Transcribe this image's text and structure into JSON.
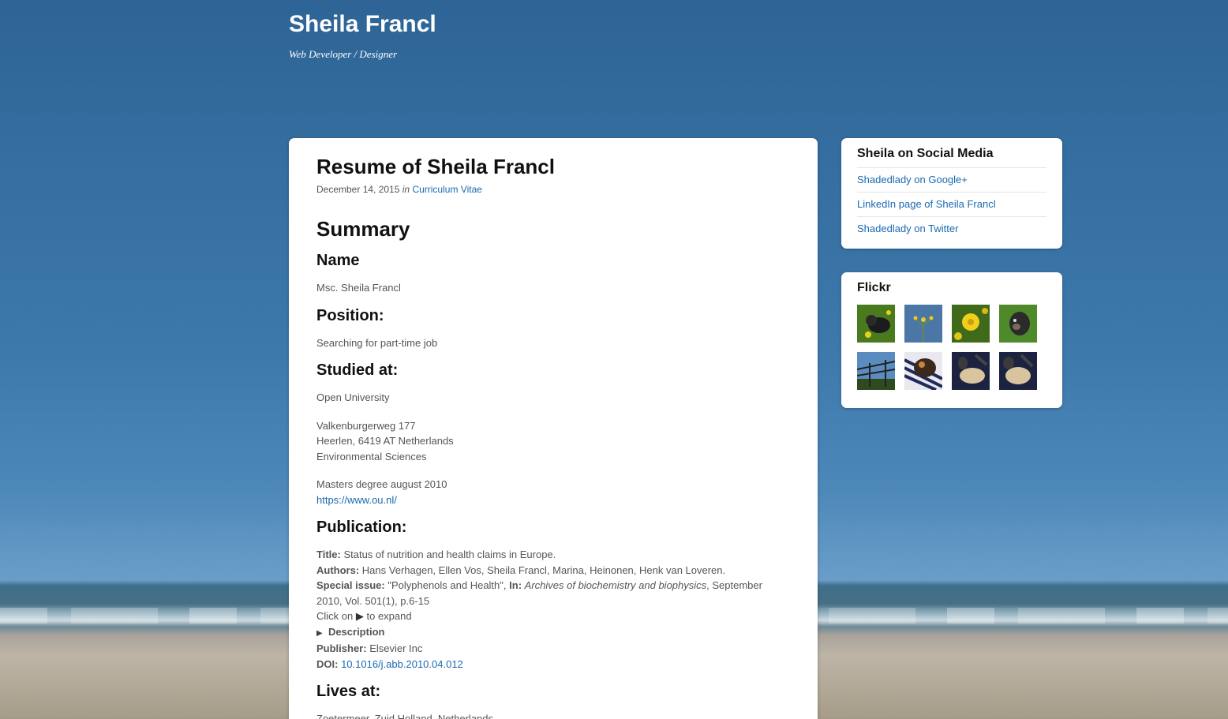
{
  "site": {
    "title": "Sheila Francl",
    "description": "Web Developer / Designer"
  },
  "post": {
    "title": "Resume of Sheila Francl",
    "date": "December 14, 2015",
    "in_word": "in",
    "category": "Curriculum Vitae",
    "summary_heading": "Summary",
    "name_heading": "Name",
    "name_value": "Msc. Sheila Francl",
    "position_heading": "Position:",
    "position_value": "Searching for part-time job",
    "studied_heading": "Studied at:",
    "studied_school": "Open University",
    "address_line1": "Valkenburgerweg 177",
    "address_line2": "Heerlen, 6419 AT Netherlands",
    "address_line3": "Environmental Sciences",
    "degree": "Masters degree august 2010",
    "school_url": "https://www.ou.nl/",
    "publication_heading": "Publication:",
    "publication": {
      "title_label": "Title:",
      "title_value": "Status of nutrition and health claims in Europe.",
      "authors_label": "Authors:",
      "authors_value": "Hans Verhagen, Ellen Vos, Sheila Francl, Marina, Heinonen, Henk van Loveren.",
      "special_label": "Special issue:",
      "special_value": "\"Polyphenols and Health\",",
      "in_label": "In:",
      "journal": "Archives of biochemistry and biophysics",
      "journal_rest": ", September 2010, Vol. 501(1), p.6-15",
      "click_prefix": "Click on",
      "click_suffix": "to expand",
      "description_label": "Description",
      "publisher_label": "Publisher:",
      "publisher_value": "Elsevier Inc",
      "doi_label": "DOI:",
      "doi_value": "10.1016/j.abb.2010.04.012"
    },
    "lives_heading": "Lives at:",
    "lives_value": "Zoetermeer, Zuid Holland, Netherlands"
  },
  "social": {
    "title": "Sheila on Social Media",
    "links": [
      "Shadedlady on Google+",
      "LinkedIn page of Sheila Francl",
      "Shadedlady on Twitter"
    ]
  },
  "flickr": {
    "title": "Flickr",
    "photos": [
      {
        "subject": "dog in grass"
      },
      {
        "subject": "yellow flowers on blue"
      },
      {
        "subject": "yellow flower"
      },
      {
        "subject": "dog in grass 2"
      },
      {
        "subject": "fence and sky"
      },
      {
        "subject": "cat on blanket"
      },
      {
        "subject": "cat paws"
      },
      {
        "subject": "cat paws 2"
      }
    ]
  },
  "colors": {
    "link": "#1a6ab0",
    "sky": "#346d9f",
    "card": "#ffffff"
  }
}
